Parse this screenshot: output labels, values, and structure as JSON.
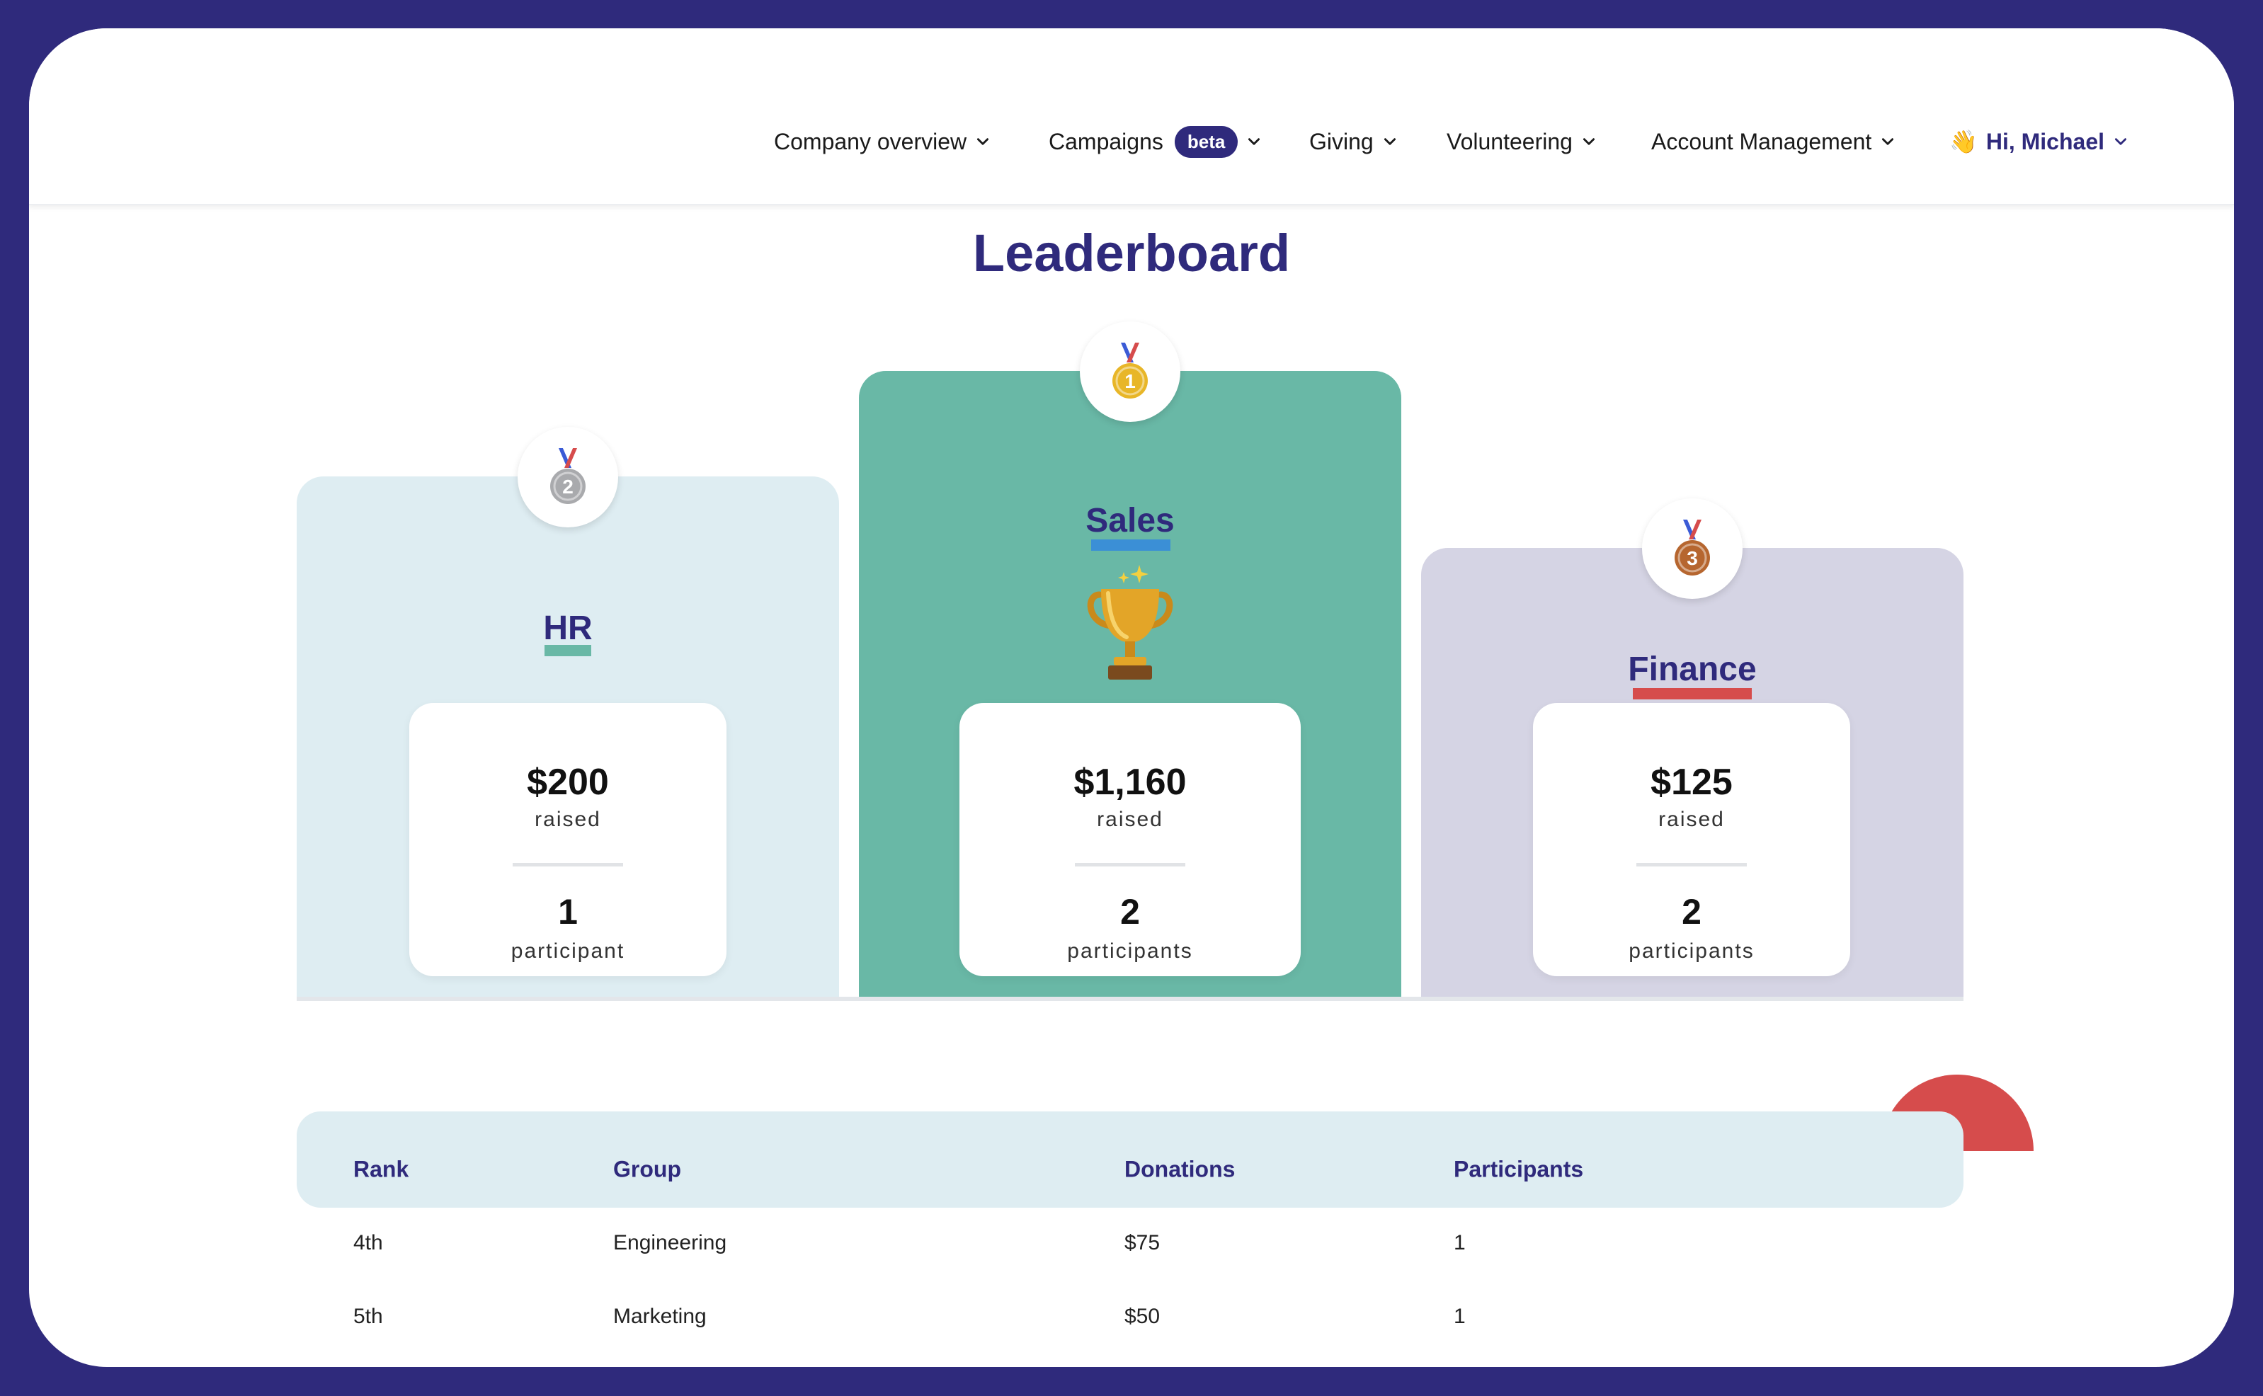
{
  "nav": {
    "items": [
      {
        "label": "Company overview"
      },
      {
        "label": "Campaigns",
        "badge": "beta"
      },
      {
        "label": "Giving"
      },
      {
        "label": "Volunteering"
      },
      {
        "label": "Account Management"
      }
    ],
    "user_greeting": "Hi, Michael",
    "user_emoji": "👋"
  },
  "page": {
    "title": "Leaderboard"
  },
  "podium": [
    {
      "rank": "2",
      "group": "HR",
      "amount": "$200",
      "amount_label": "raised",
      "participants": "1",
      "participants_label": "participant",
      "medal_color": "#a9aaad",
      "underline_color": "#69b8a6"
    },
    {
      "rank": "1",
      "group": "Sales",
      "amount": "$1,160",
      "amount_label": "raised",
      "participants": "2",
      "participants_label": "participants",
      "medal_color": "#e8b628",
      "underline_color": "#3b8fd6"
    },
    {
      "rank": "3",
      "group": "Finance",
      "amount": "$125",
      "amount_label": "raised",
      "participants": "2",
      "participants_label": "participants",
      "medal_color": "#b6662f",
      "underline_color": "#d64c4c"
    }
  ],
  "table": {
    "headers": [
      "Rank",
      "Group",
      "Donations",
      "Participants"
    ],
    "rows": [
      {
        "rank": "4th",
        "group": "Engineering",
        "donations": "$75",
        "participants": "1"
      },
      {
        "rank": "5th",
        "group": "Marketing",
        "donations": "$50",
        "participants": "1"
      }
    ]
  },
  "colors": {
    "brand": "#2f2a7c",
    "first_place": "#69b8a6",
    "second_place": "#deedf2",
    "third_place": "#d5d4e4",
    "accent_red": "#d64c4c"
  },
  "icons": {
    "trophy": "trophy-icon",
    "medal": "medal-icon",
    "chevron": "chevron-down-icon"
  }
}
